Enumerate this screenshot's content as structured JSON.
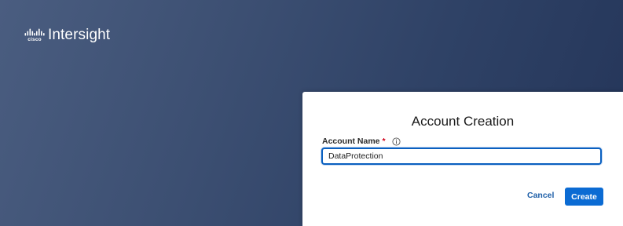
{
  "brand": {
    "logo_text": "cisco",
    "product_name": "Intersight",
    "logo_icon": "cisco-bars-icon"
  },
  "dialog": {
    "title": "Account Creation",
    "field": {
      "label": "Account Name",
      "required_mark": "*",
      "info_icon": "info-circle-icon",
      "value": "DataProtection"
    },
    "cancel_label": "Cancel",
    "create_label": "Create"
  },
  "colors": {
    "background_start": "#4a5d80",
    "background_end": "#243559",
    "primary_button": "#0b6bd3",
    "link": "#1e5fa8",
    "input_focus_border": "#0a60c0",
    "required": "#d0021b"
  }
}
